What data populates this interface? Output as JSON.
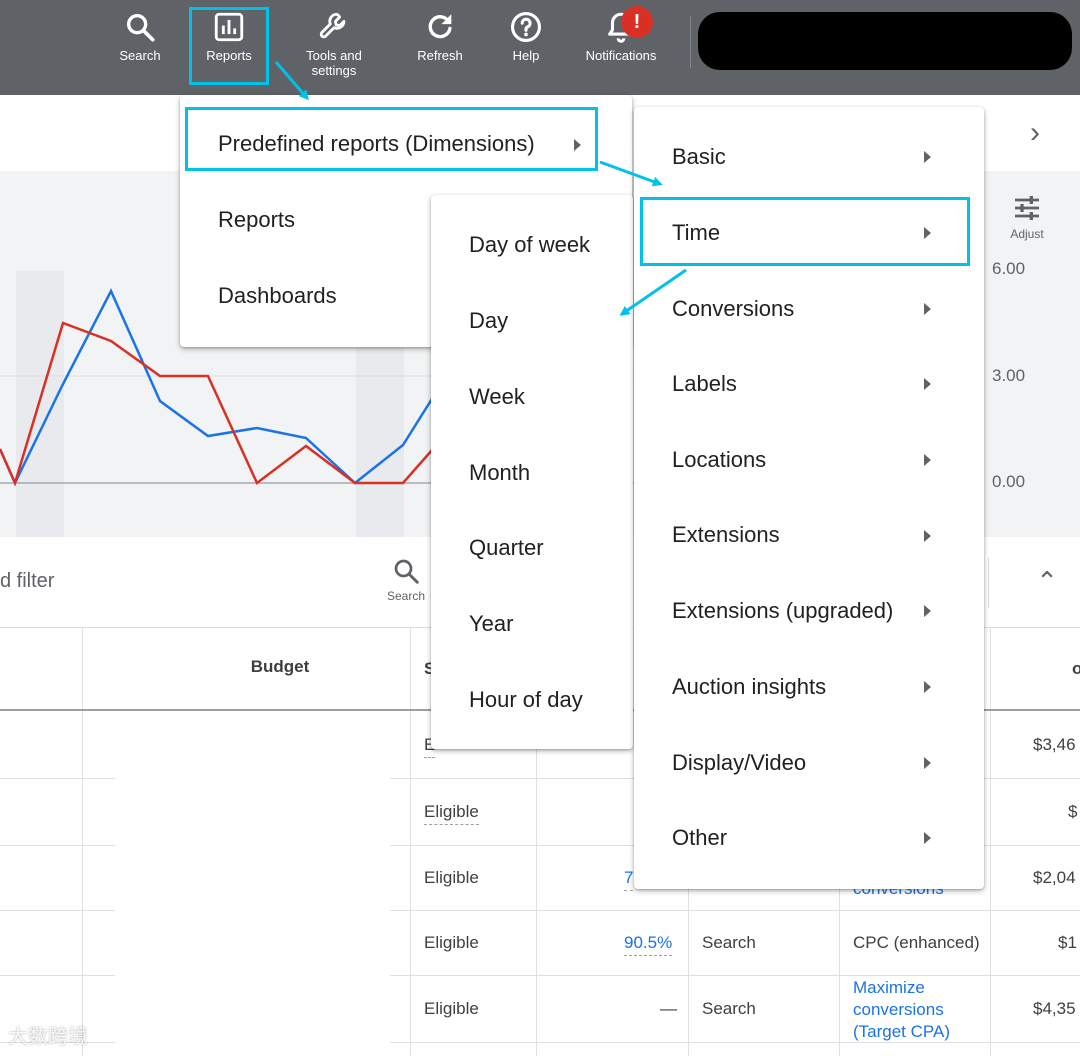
{
  "toolbar": {
    "search": "Search",
    "reports": "Reports",
    "tools_line1": "Tools and",
    "tools_line2": "settings",
    "refresh": "Refresh",
    "help": "Help",
    "notifications": "Notifications",
    "notification_badge": "!"
  },
  "chart": {
    "adjust_label": "Adjust",
    "y_right_ticks": [
      "6.00",
      "3.00",
      "0.00"
    ],
    "series_colors": {
      "blue": "#1a73e8",
      "red": "#d93025"
    }
  },
  "filter": {
    "filter_text": "d filter",
    "search_label": "Search"
  },
  "table": {
    "budget_header": "Budget",
    "partial_header_s": "S",
    "rows": [
      {
        "status": "E",
        "right": "$3,46"
      },
      {
        "status": "Eligible",
        "right": "$"
      },
      {
        "status": "Eligible",
        "opt": "7",
        "bid": "conversions",
        "right": "$2,04"
      },
      {
        "status": "Eligible",
        "opt": "90.5%",
        "type": "Search",
        "bid": "CPC (enhanced)",
        "right": "$1"
      },
      {
        "status": "Eligible",
        "opt": "—",
        "type": "Search",
        "bid_lines": [
          "Maximize",
          "conversions",
          "(Target CPA)"
        ],
        "right": "$4,35"
      }
    ]
  },
  "menu_main": {
    "items": [
      "Predefined reports (Dimensions)",
      "Reports",
      "Dashboards"
    ]
  },
  "menu_dimensions": {
    "items": [
      "Basic",
      "Time",
      "Conversions",
      "Labels",
      "Locations",
      "Extensions",
      "Extensions (upgraded)",
      "Auction insights",
      "Display/Video",
      "Other"
    ]
  },
  "menu_time": {
    "items": [
      "Day of week",
      "Day",
      "Week",
      "Month",
      "Quarter",
      "Year",
      "Hour of day"
    ]
  },
  "watermark": "大数跨境"
}
